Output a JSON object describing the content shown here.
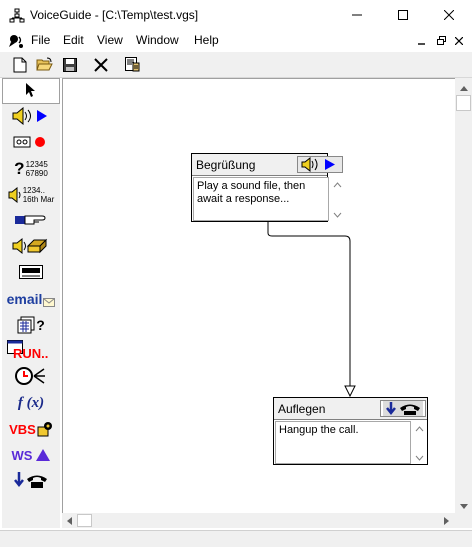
{
  "window": {
    "title": "VoiceGuide - [C:\\Temp\\test.vgs]",
    "app_icon": "org-chart-icon",
    "controls": [
      "minimize-icon",
      "maximize-icon",
      "close-icon"
    ]
  },
  "menu": {
    "items": [
      "File",
      "Edit",
      "View",
      "Window",
      "Help"
    ],
    "app_icon": "voiceguide-speaker-icon",
    "mdi_controls": [
      "mdi-minimize-icon",
      "mdi-restore-icon",
      "mdi-close-icon"
    ]
  },
  "toolbar": {
    "buttons": [
      "new-file-icon",
      "open-folder-icon",
      "save-icon",
      "delete-x-icon",
      "properties-icon"
    ]
  },
  "palette": {
    "tools": [
      {
        "name": "pointer-icon"
      },
      {
        "name": "play-sound-icon"
      },
      {
        "name": "record-icon"
      },
      {
        "name": "get-numbers-icon",
        "label": "?12345 67890"
      },
      {
        "name": "say-numbers-icon",
        "label": "1234.. 16th Mar"
      },
      {
        "name": "transfer-call-icon"
      },
      {
        "name": "voicemail-icon"
      },
      {
        "name": "pager-icon"
      },
      {
        "name": "email-icon",
        "label": "email"
      },
      {
        "name": "database-query-icon"
      },
      {
        "name": "run-program-icon",
        "label": "RUN.."
      },
      {
        "name": "time-switch-icon"
      },
      {
        "name": "evaluate-expression-icon",
        "label": "f (x)"
      },
      {
        "name": "vbs-script-icon",
        "label": "VBS"
      },
      {
        "name": "web-service-icon",
        "label": "WS"
      },
      {
        "name": "hangup-icon"
      }
    ]
  },
  "flow": {
    "nodes": [
      {
        "title": "Begrüßung",
        "text": "Play a sound file, then await a response...",
        "icon": "play-sound-icon"
      },
      {
        "title": "Auflegen",
        "text": "Hangup the call.",
        "icon": "hangup-icon"
      }
    ]
  },
  "colors": {
    "play_arrow": "#0000ff",
    "record_dot": "#ff0000",
    "email_text": "#1f3fa0",
    "run_text": "#ff0000",
    "vbs_text": "#ff0000",
    "ws_text": "#5a2ad8",
    "fx_text": "#1a2a8a"
  }
}
